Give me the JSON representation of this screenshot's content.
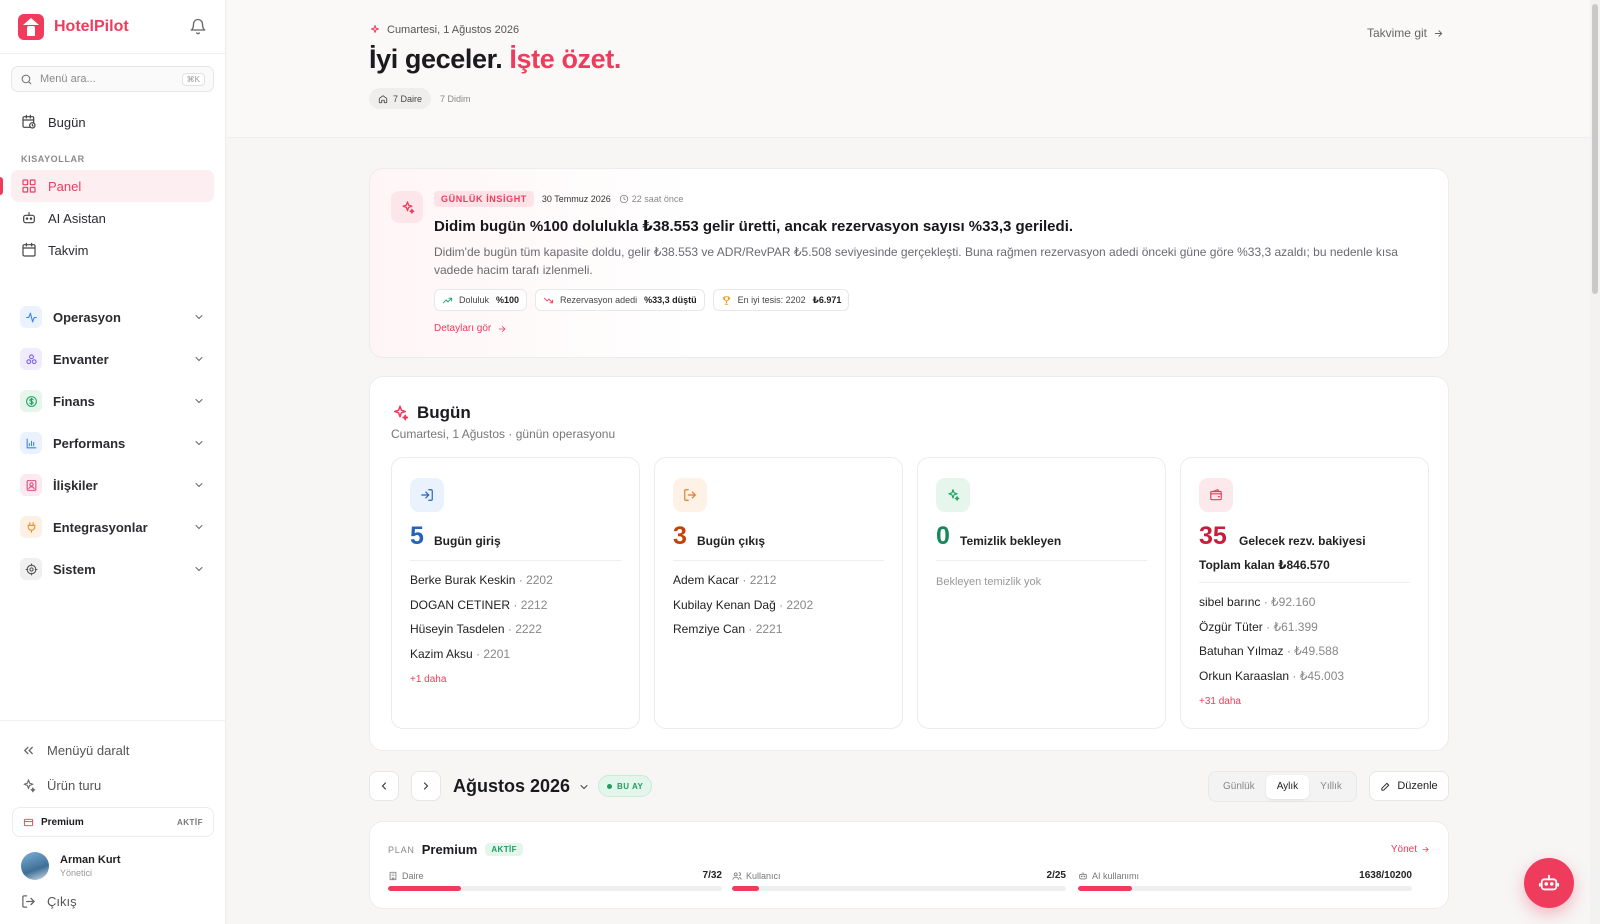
{
  "sidebar": {
    "brand": "HotelPilot",
    "search_placeholder": "Menü ara...",
    "search_shortcut": "⌘K",
    "today_label": "Bugün",
    "shortcuts_label": "KISAYOLLAR",
    "shortcuts": [
      {
        "label": "Panel",
        "icon": "grid-icon",
        "active": true
      },
      {
        "label": "AI Asistan",
        "icon": "robot-icon",
        "active": false
      },
      {
        "label": "Takvim",
        "icon": "calendar-icon",
        "active": false
      }
    ],
    "groups": [
      {
        "label": "Operasyon",
        "icon": "activity-icon",
        "color": "#3b82f6",
        "bg": "#eaf2fe"
      },
      {
        "label": "Envanter",
        "icon": "cubes-icon",
        "color": "#7c5ce6",
        "bg": "#f0ecfd"
      },
      {
        "label": "Finans",
        "icon": "dollar-icon",
        "color": "#1fa564",
        "bg": "#e6f6ed"
      },
      {
        "label": "Performans",
        "icon": "bar-chart-icon",
        "color": "#3b82f6",
        "bg": "#eaf2fe"
      },
      {
        "label": "İlişkiler",
        "icon": "contact-icon",
        "color": "#e4477a",
        "bg": "#fde9f0"
      },
      {
        "label": "Entegrasyonlar",
        "icon": "plug-icon",
        "color": "#f08a24",
        "bg": "#fef1e4"
      },
      {
        "label": "Sistem",
        "icon": "gear-icon",
        "color": "#555555",
        "bg": "#f0f0f0"
      }
    ],
    "collapse_label": "Menüyü daralt",
    "tour_label": "Ürün turu",
    "plan_label": "Premium",
    "plan_status": "AKTİF",
    "user_name": "Arman Kurt",
    "user_role": "Yönetici",
    "logout_label": "Çıkış"
  },
  "header": {
    "date": "Cumartesi, 1 Ağustos 2026",
    "greeting_start": "İyi geceler.",
    "greeting_accent": "İşte özet.",
    "chip_units": "7 Daire",
    "chip_location": "7 Didim",
    "goto_calendar": "Takvime git"
  },
  "insight": {
    "badge": "GÜNLÜK İNSİGHT",
    "date": "30 Temmuz 2026",
    "ago": "22 saat önce",
    "title": "Didim bugün %100 dolulukla ₺38.553 gelir üretti, ancak rezervasyon sayısı %33,3 geriledi.",
    "text": "Didim'de bugün tüm kapasite doldu, gelir ₺38.553 ve ADR/RevPAR ₺5.508 seviyesinde gerçekleşti. Buna rağmen rezervasyon adedi önceki güne göre %33,3 azaldı; bu nedenle kısa vadede hacim tarafı izlenmeli.",
    "pills": [
      {
        "label": "Doluluk",
        "value": "%100",
        "icon": "trend-up-icon",
        "color": "#1fa564"
      },
      {
        "label": "Rezervasyon adedi",
        "value": "%33,3 düştü",
        "icon": "trend-down-icon",
        "color": "#ef3b5c"
      },
      {
        "label": "En iyi tesis: 2202",
        "value": "₺6.971",
        "icon": "trophy-icon",
        "color": "#e39b16"
      }
    ],
    "details_link": "Detayları gör"
  },
  "today": {
    "title": "Bugün",
    "subtitle": "Cumartesi, 1 Ağustos · günün operasyonu",
    "checkin": {
      "count": "5",
      "label": "Bugün giriş",
      "color": "#2563b8",
      "icon_bg": "#e9f2fd",
      "items": [
        {
          "name": "Berke Burak Keskin",
          "unit": "· 2202"
        },
        {
          "name": "DOGAN CETINER",
          "unit": "· 2212"
        },
        {
          "name": "Hüseyin Tasdelen",
          "unit": "· 2222"
        },
        {
          "name": "Kazim Aksu",
          "unit": "· 2201"
        }
      ],
      "more": "+1 daha"
    },
    "checkout": {
      "count": "3",
      "label": "Bugün çıkış",
      "color": "#c2410c",
      "icon_bg": "#fef2e6",
      "items": [
        {
          "name": "Adem Kacar",
          "unit": "· 2212"
        },
        {
          "name": "Kubilay Kenan Dağ",
          "unit": "· 2202"
        },
        {
          "name": "Remziye Can",
          "unit": "· 2221"
        }
      ]
    },
    "cleaning": {
      "count": "0",
      "label": "Temizlik bekleyen",
      "color": "#16885a",
      "icon_bg": "#e6f6ed",
      "empty": "Bekleyen temizlik yok"
    },
    "balance": {
      "count": "35",
      "label": "Gelecek rezv. bakiyesi",
      "color": "#c81e3a",
      "icon_bg": "#fde8ec",
      "total": "Toplam kalan ₺846.570",
      "items": [
        {
          "name": "sibel barınc",
          "unit": "· ₺92.160"
        },
        {
          "name": "Özgür Tüter",
          "unit": "· ₺61.399"
        },
        {
          "name": "Batuhan Yılmaz",
          "unit": "· ₺49.588"
        },
        {
          "name": "Orkun Karaaslan",
          "unit": "· ₺45.003"
        }
      ],
      "more": "+31 daha"
    }
  },
  "calendar_bar": {
    "month": "Ağustos 2026",
    "this_month": "BU AY",
    "views": [
      "Günlük",
      "Aylık",
      "Yıllık"
    ],
    "selected_view": "Aylık",
    "edit_label": "Düzenle"
  },
  "plan": {
    "label": "PLAN",
    "name": "Premium",
    "status": "AKTİF",
    "manage": "Yönet",
    "usage": [
      {
        "label": "Daire",
        "value": "7/32",
        "fraction": 0.219,
        "icon": "building-icon"
      },
      {
        "label": "Kullanıcı",
        "value": "2/25",
        "fraction": 0.08,
        "icon": "users-icon"
      },
      {
        "label": "AI kullanımı",
        "value": "1638/10200",
        "fraction": 0.161,
        "icon": "robot-icon"
      }
    ]
  },
  "colors": {
    "accent": "#ef3b5c",
    "success": "#239a5e"
  }
}
